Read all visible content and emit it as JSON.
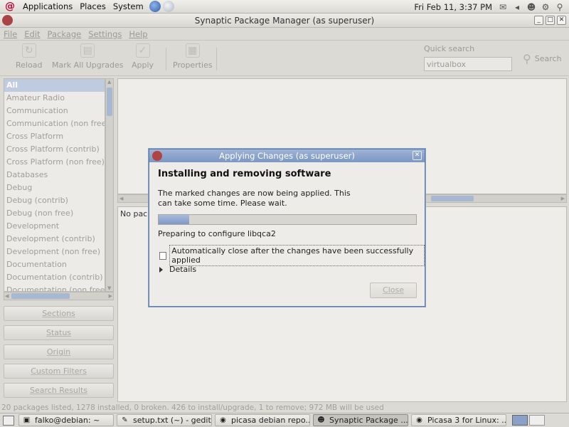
{
  "panel": {
    "menus": [
      "Applications",
      "Places",
      "System"
    ],
    "clock": "Fri Feb 11,  3:37 PM"
  },
  "window": {
    "title": "Synaptic Package Manager  (as superuser)",
    "controls": [
      "_",
      "□",
      "✕"
    ]
  },
  "menubar": [
    "File",
    "Edit",
    "Package",
    "Settings",
    "Help"
  ],
  "toolbar": {
    "reload": "Reload",
    "mark_all": "Mark All Upgrades",
    "apply": "Apply",
    "properties": "Properties",
    "quick_search_label": "Quick search",
    "quick_search_value": "virtualbox",
    "search": "Search"
  },
  "categories": [
    "All",
    "Amateur Radio",
    "Communication",
    "Communication (non free)",
    "Cross Platform",
    "Cross Platform (contrib)",
    "Cross Platform (non free)",
    "Databases",
    "Debug",
    "Debug (contrib)",
    "Debug (non free)",
    "Development",
    "Development (contrib)",
    "Development (non free)",
    "Documentation",
    "Documentation (contrib)",
    "Documentation (non free)"
  ],
  "filters": [
    "Sections",
    "Status",
    "Origin",
    "Custom Filters",
    "Search Results"
  ],
  "description": "No package is selected.",
  "statusbar": "20 packages listed, 1278 installed, 0 broken. 426 to install/upgrade, 1 to remove; 972 MB will be used",
  "dialog": {
    "title": "Applying Changes (as superuser)",
    "heading": "Installing and removing software",
    "message": "The marked changes are now being applied. This can take some time. Please wait.",
    "progress": 0.12,
    "status": "Preparing to configure libqca2",
    "auto_close_label": "Automatically close after the changes have been successfully applied",
    "auto_close_checked": false,
    "details": "Details",
    "close": "Close"
  },
  "taskbar": [
    "falko@debian: ~",
    "setup.txt (~) - gedit",
    "picasa debian repo...",
    "Synaptic Package ...",
    "Picasa 3 for Linux: ..."
  ],
  "colors": {
    "accent": "#7b97c4",
    "selection": "#bfcbe0",
    "disabled_text": "#9c9a95"
  },
  "icons": {
    "distro": "debian-swirl-icon",
    "reload": "reload-icon",
    "mark_all": "upgrade-icon",
    "apply": "checkmark-icon",
    "properties": "properties-icon",
    "search": "magnifier-icon"
  }
}
